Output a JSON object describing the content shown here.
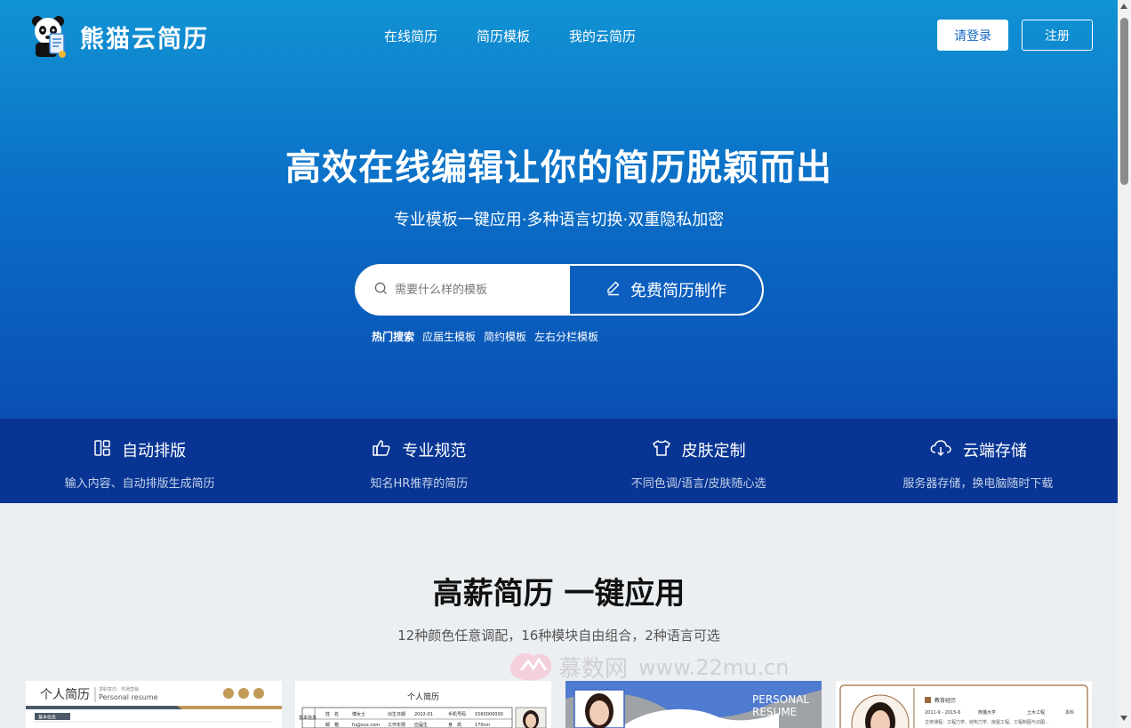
{
  "header": {
    "brand": "熊猫云简历",
    "nav": [
      "在线简历",
      "简历模板",
      "我的云简历"
    ],
    "login_label": "请登录",
    "register_label": "注册"
  },
  "hero": {
    "title": "高效在线编辑让你的简历脱颖而出",
    "subtitle": "专业模板一键应用·多种语言切换·双重隐私加密",
    "search_placeholder": "需要什么样的模板",
    "make_label": "免费简历制作",
    "hot_label": "热门搜索",
    "hot_terms": [
      "应届生模板",
      "简约模板",
      "左右分栏模板"
    ]
  },
  "features": [
    {
      "title": "自动排版",
      "desc": "输入内容、自动排版生成简历",
      "icon": "layout-icon"
    },
    {
      "title": "专业规范",
      "desc": "知名HR推荐的简历",
      "icon": "thumbs-up-icon"
    },
    {
      "title": "皮肤定制",
      "desc": "不同色调/语言/皮肤随心选",
      "icon": "shirt-icon"
    },
    {
      "title": "云端存储",
      "desc": "服务器存储，换电脑随时下载",
      "icon": "cloud-icon"
    }
  ],
  "section": {
    "title": "高薪简历 一键应用",
    "subtitle": "12种颜色任意调配，16种模块自由组合，2种语言可选"
  },
  "watermark": {
    "name": "慕数网",
    "url": "www.22mu.cn"
  },
  "cards": {
    "c1": {
      "title": "个人简历",
      "tagline_1": "求职意向：市场营销",
      "en": "Personal resume",
      "section": "基本信息"
    },
    "c2": {
      "title": "个人简历",
      "row1": [
        "姓　名",
        "傅女士",
        "出生日期",
        "2022-01",
        "手机号码",
        "1560000000"
      ],
      "row2": [
        "邮　箱",
        "fu@xxx.com",
        "工作年限",
        "应届生",
        "身　高",
        "170cm"
      ],
      "side": "基本信息"
    },
    "c3": {
      "en1": "PERSONAL",
      "en2": "RESUME"
    },
    "c4": {
      "section": "教育经历",
      "row1": [
        "2011-9 - 2015-6",
        "熊猫大学",
        "土木工程",
        "本科"
      ],
      "row2": "主修课程：工程力学、结构力学、房屋工程、工程制图与识图..."
    }
  },
  "colors": {
    "accent": "#0d5fbf",
    "feature_bar": "#083593",
    "hero_top": "#1193d3"
  }
}
